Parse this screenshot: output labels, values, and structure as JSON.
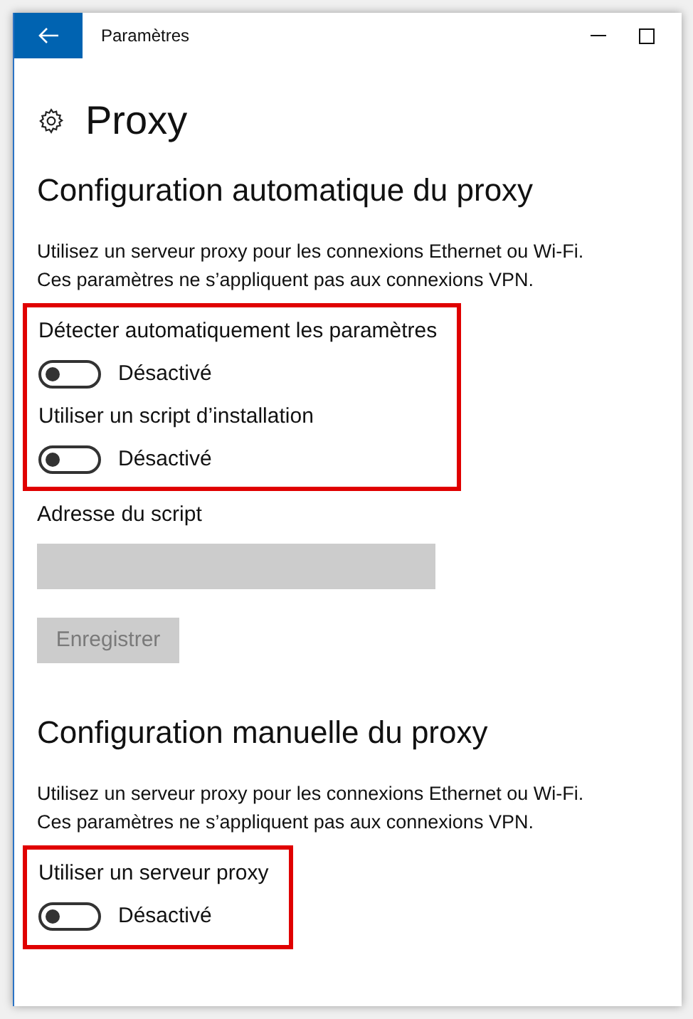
{
  "window": {
    "title": "Paramètres"
  },
  "page_title": "Proxy",
  "sections": [
    {
      "heading": "Configuration automatique du proxy",
      "description": [
        "Utilisez un serveur proxy pour les connexions Ethernet ou Wi-Fi.",
        "Ces paramètres ne s’appliquent pas aux connexions VPN."
      ],
      "groups": [
        {
          "highlighted": true,
          "toggles": [
            {
              "label": "Détecter automatiquement les paramètres",
              "on": false,
              "state_text": "Désactivé"
            },
            {
              "label": "Utiliser un script d’installation",
              "on": false,
              "state_text": "Désactivé"
            }
          ]
        }
      ],
      "field": {
        "label": "Adresse du script",
        "disabled": true
      },
      "button": {
        "label": "Enregistrer",
        "disabled": true
      }
    },
    {
      "heading": "Configuration manuelle du proxy",
      "description": [
        "Utilisez un serveur proxy pour les connexions Ethernet ou Wi-Fi.",
        "Ces paramètres ne s’appliquent pas aux connexions VPN."
      ],
      "groups": [
        {
          "highlighted": true,
          "toggles": [
            {
              "label": "Utiliser un serveur proxy",
              "on": false,
              "state_text": "Désactivé"
            }
          ]
        }
      ]
    }
  ]
}
